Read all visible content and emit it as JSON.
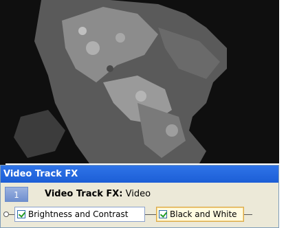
{
  "panel": {
    "title": "Video Track FX",
    "track_number": "1",
    "track_label_bold": "Video Track FX:",
    "track_label_value": " Video"
  },
  "chain": {
    "items": [
      {
        "label": "Brightness and Contrast",
        "checked": true
      },
      {
        "label": "Black and White",
        "checked": true
      }
    ]
  }
}
